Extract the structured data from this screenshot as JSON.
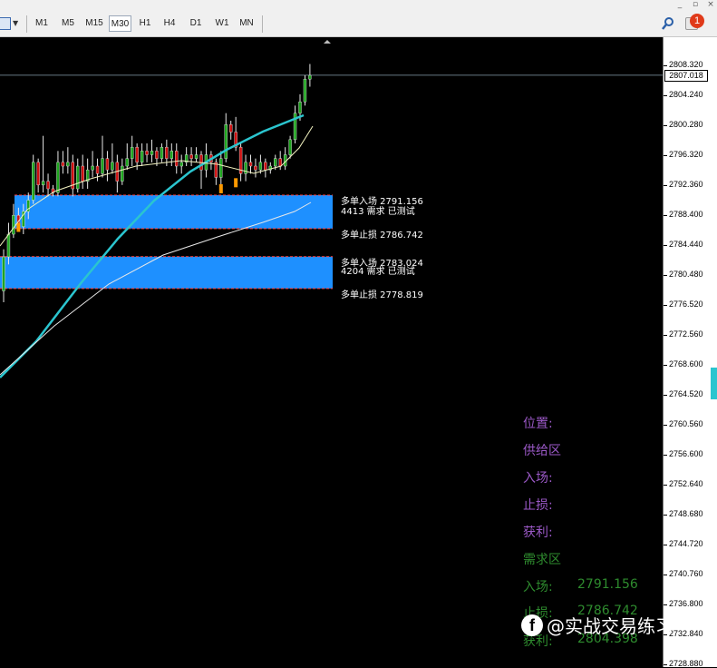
{
  "toolbar": {
    "timeframes": [
      "M1",
      "M5",
      "M15",
      "M30",
      "H1",
      "H4",
      "D1",
      "W1",
      "MN"
    ],
    "active_timeframe": "M30",
    "notification_count": "1"
  },
  "axis": {
    "ticks": [
      "2808.320",
      "2804.240",
      "2800.280",
      "2796.320",
      "2792.360",
      "2788.400",
      "2784.440",
      "2780.480",
      "2776.520",
      "2772.560",
      "2768.600",
      "2764.520",
      "2760.560",
      "2756.600",
      "2752.640",
      "2748.680",
      "2744.720",
      "2740.760",
      "2736.800",
      "2732.840",
      "2728.880"
    ],
    "current_price": "2807.018"
  },
  "zones": {
    "zone1": {
      "entry": "多单入场 2791.156",
      "demand": "4413 需求 已测试",
      "stop": "多单止损 2786.742"
    },
    "zone2": {
      "entry": "多单入场 2783.024",
      "demand": "4204 需求 已测试",
      "stop": "多单止损 2778.819"
    }
  },
  "info_panel": {
    "supply": {
      "position_label": "位置:",
      "zone_label": "供给区",
      "entry_label": "入场:",
      "stop_label": "止损:",
      "profit_label": "获利:"
    },
    "demand": {
      "zone_label": "需求区",
      "entry_label": "入场:",
      "entry_value": "2791.156",
      "stop_label": "止损:",
      "stop_value": "2786.742",
      "profit_label": "获利:",
      "profit_value": "2804.398"
    }
  },
  "watermark": {
    "logo": "f",
    "text": "@实战交易练习"
  },
  "colors": {
    "bull": "#2bb52b",
    "bear": "#d01010",
    "zone": "#1e90ff",
    "ma_fast": "#2bc5cf",
    "ma_slow": "#e8e8e8",
    "signal": "#ff9900"
  },
  "candles": [
    [
      2778.5,
      2783.0,
      2777.0,
      2784.0
    ],
    [
      2783.0,
      2786.0,
      2782.0,
      2787.5
    ],
    [
      2786.0,
      2788.5,
      2785.5,
      2790.0
    ],
    [
      2788.5,
      2787.0,
      2786.5,
      2789.5
    ],
    [
      2787.0,
      2789.0,
      2786.0,
      2790.0
    ],
    [
      2789.0,
      2790.5,
      2788.0,
      2791.5
    ],
    [
      2790.5,
      2795.5,
      2790.0,
      2796.5
    ],
    [
      2795.5,
      2792.5,
      2791.5,
      2796.0
    ],
    [
      2792.5,
      2793.0,
      2791.5,
      2799.0
    ],
    [
      2793.0,
      2792.0,
      2791.0,
      2794.0
    ],
    [
      2792.0,
      2791.5,
      2791.0,
      2792.5
    ],
    [
      2791.5,
      2795.5,
      2791.0,
      2797.0
    ],
    [
      2795.5,
      2795.0,
      2794.0,
      2797.0
    ],
    [
      2795.0,
      2795.5,
      2794.0,
      2797.5
    ],
    [
      2795.5,
      2792.0,
      2791.0,
      2796.5
    ],
    [
      2792.0,
      2795.0,
      2791.5,
      2796.0
    ],
    [
      2795.0,
      2793.0,
      2792.0,
      2796.5
    ],
    [
      2793.0,
      2794.5,
      2792.0,
      2796.0
    ],
    [
      2794.5,
      2795.0,
      2793.5,
      2797.0
    ],
    [
      2795.0,
      2794.0,
      2793.0,
      2796.0
    ],
    [
      2794.0,
      2796.0,
      2793.5,
      2799.0
    ],
    [
      2796.0,
      2794.5,
      2793.0,
      2797.0
    ],
    [
      2794.5,
      2795.5,
      2794.0,
      2798.0
    ],
    [
      2795.5,
      2793.0,
      2791.5,
      2796.5
    ],
    [
      2793.0,
      2795.0,
      2792.5,
      2796.0
    ],
    [
      2795.0,
      2796.0,
      2794.5,
      2798.0
    ],
    [
      2796.0,
      2797.5,
      2795.0,
      2799.0
    ],
    [
      2797.5,
      2795.5,
      2794.5,
      2798.0
    ],
    [
      2795.5,
      2797.0,
      2795.0,
      2798.0
    ],
    [
      2797.0,
      2796.5,
      2795.5,
      2798.0
    ],
    [
      2796.5,
      2797.0,
      2795.5,
      2798.5
    ],
    [
      2797.0,
      2796.0,
      2795.0,
      2797.5
    ],
    [
      2796.0,
      2797.5,
      2795.5,
      2798.0
    ],
    [
      2797.5,
      2796.0,
      2795.0,
      2798.5
    ],
    [
      2796.0,
      2797.0,
      2795.0,
      2798.0
    ],
    [
      2797.0,
      2795.0,
      2794.0,
      2798.0
    ],
    [
      2795.0,
      2795.5,
      2794.0,
      2796.5
    ],
    [
      2795.5,
      2796.5,
      2795.0,
      2797.5
    ],
    [
      2796.5,
      2796.0,
      2795.0,
      2797.5
    ],
    [
      2796.0,
      2796.5,
      2795.5,
      2797.5
    ],
    [
      2796.5,
      2794.5,
      2792.0,
      2797.0
    ],
    [
      2794.5,
      2796.5,
      2793.5,
      2798.0
    ],
    [
      2796.5,
      2795.5,
      2794.5,
      2797.0
    ],
    [
      2795.5,
      2793.5,
      2792.5,
      2796.0
    ],
    [
      2793.5,
      2796.0,
      2792.0,
      2797.0
    ],
    [
      2796.0,
      2800.5,
      2795.5,
      2802.0
    ],
    [
      2800.5,
      2799.5,
      2798.5,
      2801.0
    ],
    [
      2799.5,
      2797.5,
      2797.0,
      2801.5
    ],
    [
      2797.5,
      2794.0,
      2793.0,
      2798.0
    ],
    [
      2794.0,
      2795.5,
      2793.0,
      2796.5
    ],
    [
      2795.5,
      2795.0,
      2794.0,
      2796.5
    ],
    [
      2795.0,
      2794.5,
      2793.5,
      2796.0
    ],
    [
      2794.5,
      2795.5,
      2794.0,
      2796.5
    ],
    [
      2795.5,
      2794.5,
      2793.5,
      2796.0
    ],
    [
      2794.5,
      2795.0,
      2794.0,
      2795.5
    ],
    [
      2795.0,
      2796.0,
      2794.5,
      2796.5
    ],
    [
      2796.0,
      2795.0,
      2794.5,
      2797.0
    ],
    [
      2795.0,
      2796.5,
      2794.5,
      2797.5
    ],
    [
      2796.5,
      2798.5,
      2796.0,
      2799.0
    ],
    [
      2798.5,
      2802.0,
      2798.0,
      2803.0
    ],
    [
      2802.0,
      2803.5,
      2801.0,
      2804.5
    ],
    [
      2803.5,
      2806.5,
      2803.0,
      2807.0
    ],
    [
      2806.5,
      2807.0,
      2805.5,
      2808.5
    ]
  ]
}
